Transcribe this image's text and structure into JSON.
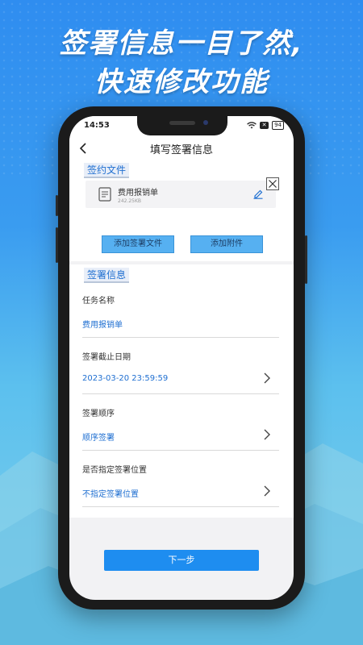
{
  "headline": {
    "line1": "签署信息一目了然,",
    "line2": "快速修改功能"
  },
  "status_bar": {
    "time": "14:53",
    "x_badge": "✕",
    "battery": "94"
  },
  "nav": {
    "title": "填写签署信息",
    "back_icon": "chevron-left-icon"
  },
  "contract_files": {
    "section_title": "签约文件",
    "file": {
      "name": "费用报销单",
      "size": "242.25KB",
      "icon": "document-icon"
    },
    "buttons": {
      "add_signing_file": "添加签署文件",
      "add_attachment": "添加附件"
    }
  },
  "signing_info": {
    "section_title": "签署信息",
    "fields": [
      {
        "label": "任务名称",
        "value": "费用报销单"
      },
      {
        "label": "签署截止日期",
        "value": "2023-03-20 23:59:59"
      },
      {
        "label": "签署顺序",
        "value": "顺序签署"
      },
      {
        "label": "是否指定签署位置",
        "value": "不指定签署位置"
      }
    ]
  },
  "next_button": "下一步",
  "colors": {
    "accent": "#1e8df0",
    "link_blue": "#1f6fd1",
    "button_light": "#56b0f1"
  }
}
